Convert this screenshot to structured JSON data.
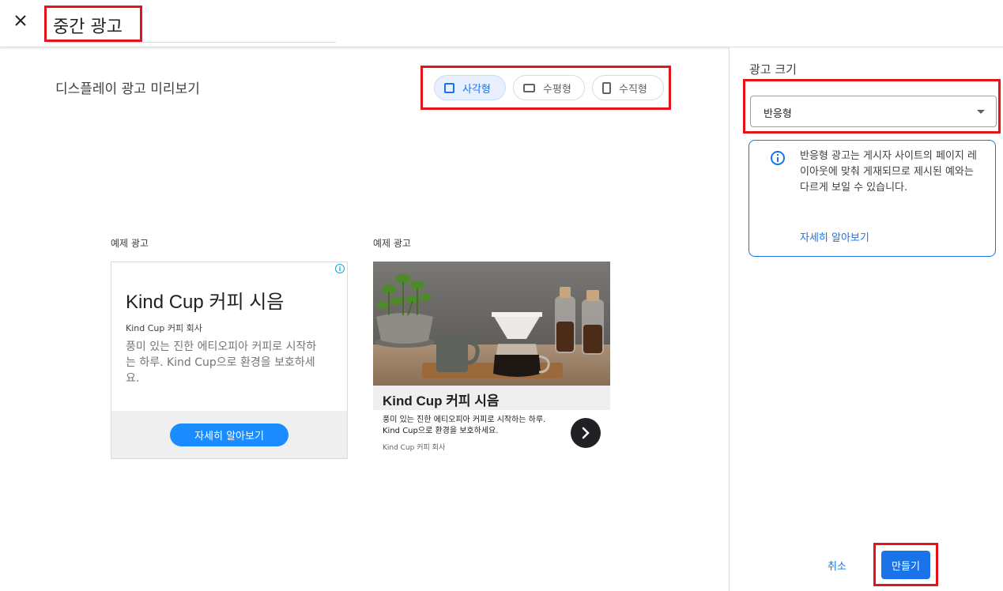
{
  "header": {
    "close_icon": "close-icon",
    "title": "중간 광고"
  },
  "preview": {
    "heading": "디스플레이 광고 미리보기",
    "formats": [
      {
        "label": "사각형",
        "icon": "square-icon",
        "selected": true
      },
      {
        "label": "수평형",
        "icon": "landscape-icon",
        "selected": false
      },
      {
        "label": "수직형",
        "icon": "portrait-icon",
        "selected": false
      }
    ],
    "samples": [
      {
        "label": "예제 광고",
        "headline": "Kind Cup 커피 시음",
        "advertiser": "Kind Cup 커피 회사",
        "description": "풍미 있는 진한 에티오피아 커피로 시작하는 하루. Kind Cup으로 환경을 보호하세요.",
        "cta": "자세히 알아보기",
        "badge_icon": "ad-choices-icon"
      },
      {
        "label": "예제 광고",
        "image": "coffee-pour-over-photo",
        "headline": "Kind Cup 커피 시음",
        "description": "풍미 있는 진한 에티오피아 커피로 시작하는 하루. Kind Cup으로 환경을 보호하세요.",
        "advertiser": "Kind Cup 커피 회사",
        "next_icon": "chevron-right-icon"
      }
    ]
  },
  "sidebar": {
    "size_label": "광고 크기",
    "size_value": "반응형",
    "notice": {
      "icon": "info-icon",
      "text": "반응형 광고는 게시자 사이트의 페이지 레이아웃에 맞춰 게재되므로 제시된 예와는 다르게 보일 수 있습니다.",
      "link": "자세히 알아보기"
    }
  },
  "footer": {
    "cancel": "취소",
    "create": "만들기"
  },
  "colors": {
    "accent": "#1a73e8",
    "highlight_box": "#e4141c",
    "ad_cta": "#1a8cff"
  }
}
